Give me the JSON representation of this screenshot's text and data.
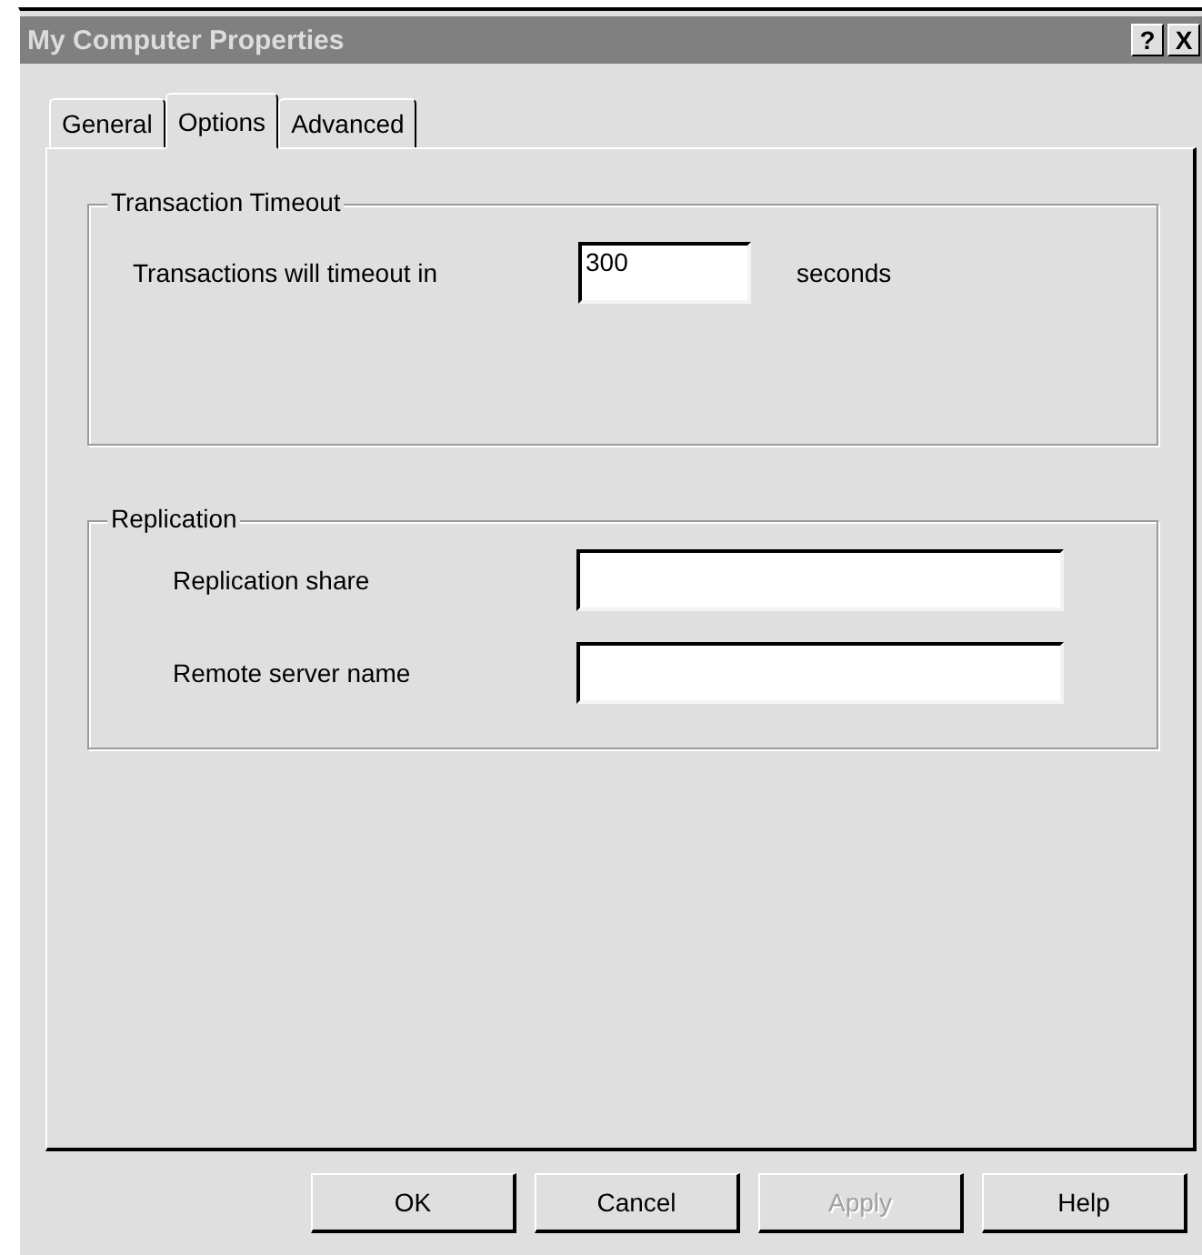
{
  "window": {
    "title": "My Computer Properties",
    "help_button": "?",
    "close_button": "X"
  },
  "tabs": [
    {
      "label": "General",
      "selected": false
    },
    {
      "label": "Options",
      "selected": true
    },
    {
      "label": "Advanced",
      "selected": false
    }
  ],
  "groups": [
    {
      "title": "Transaction Timeout",
      "fields": [
        {
          "label": "Transactions will timeout in",
          "value": "300",
          "suffix": "seconds",
          "kind": "short"
        }
      ]
    },
    {
      "title": "Replication",
      "fields": [
        {
          "label": "Replication share",
          "kind": "long"
        },
        {
          "label": "Remote server name",
          "kind": "long"
        }
      ]
    }
  ],
  "buttons": [
    {
      "label": "OK",
      "disabled": false
    },
    {
      "label": "Cancel",
      "disabled": false
    },
    {
      "label": "Apply",
      "disabled": true
    },
    {
      "label": "Help",
      "disabled": false
    }
  ]
}
